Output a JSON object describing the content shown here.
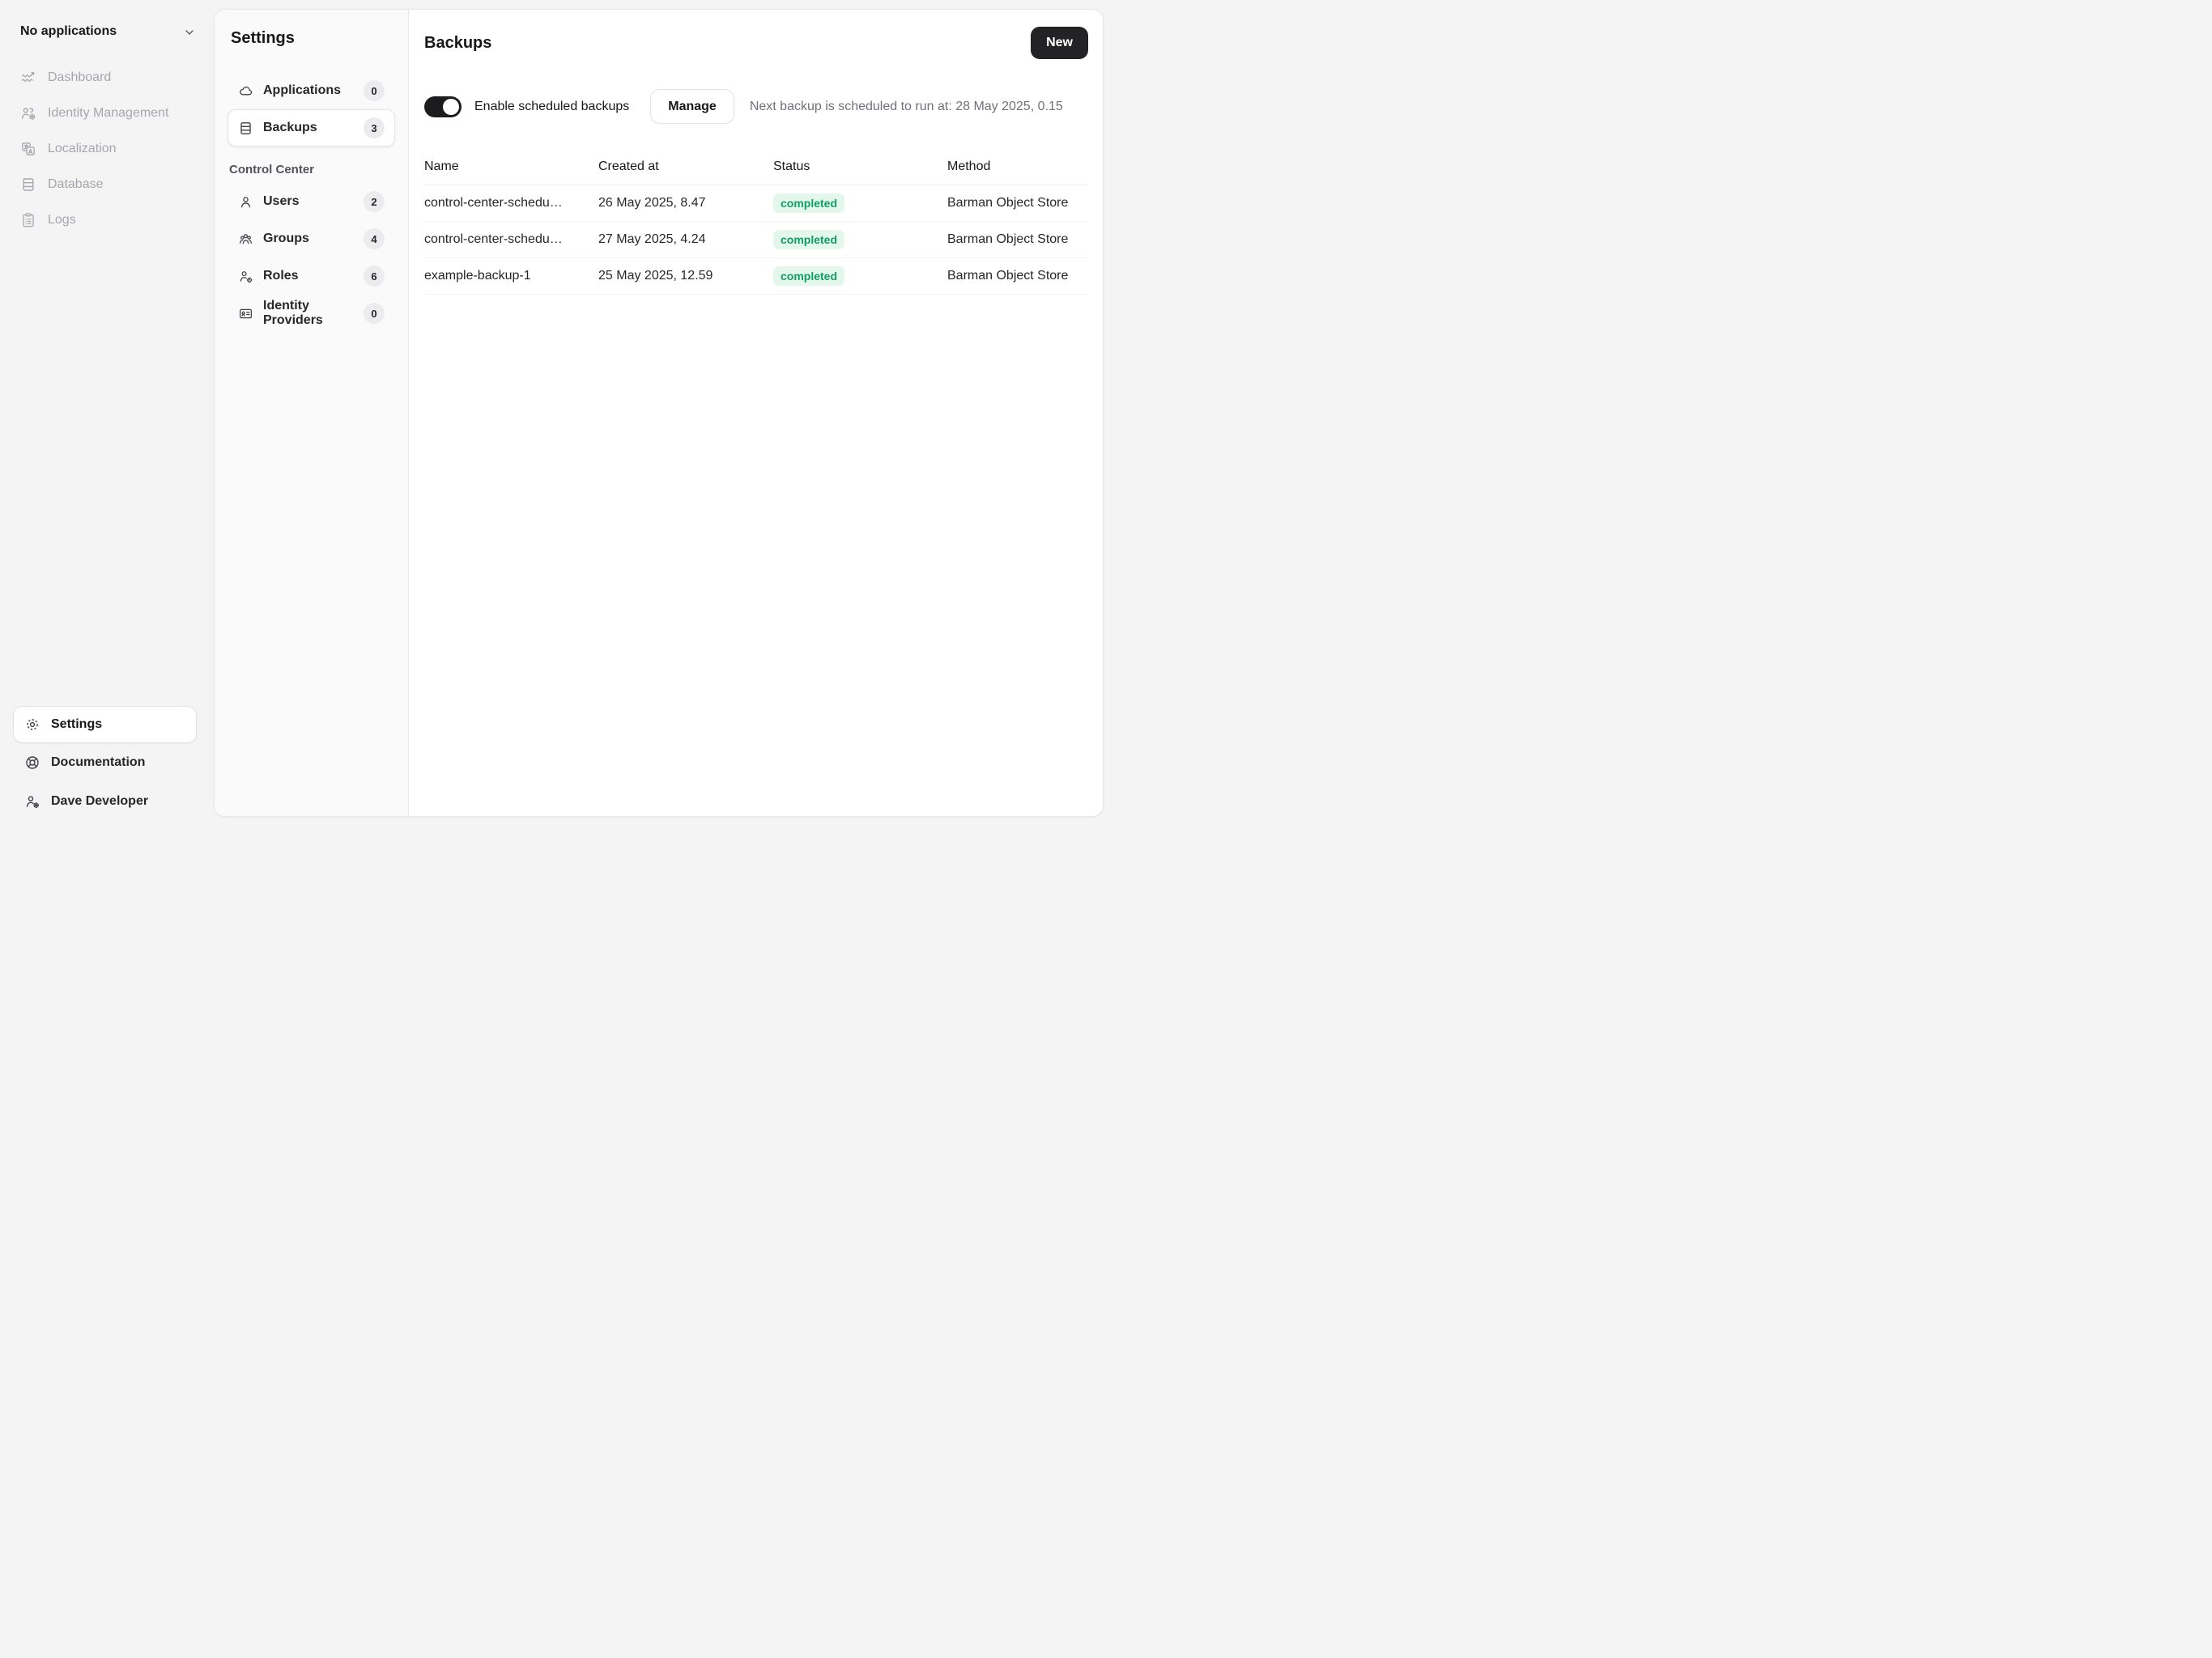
{
  "sidebar": {
    "app_switcher": {
      "label": "No applications"
    },
    "nav": [
      {
        "label": "Dashboard",
        "icon": "activity-icon"
      },
      {
        "label": "Identity Management",
        "icon": "users-gear-icon"
      },
      {
        "label": "Localization",
        "icon": "translate-icon"
      },
      {
        "label": "Database",
        "icon": "database-icon"
      },
      {
        "label": "Logs",
        "icon": "logs-icon"
      }
    ],
    "footer": {
      "settings_label": "Settings",
      "documentation_label": "Documentation",
      "user_label": "Dave Developer"
    }
  },
  "settings_nav": {
    "title": "Settings",
    "items": [
      {
        "label": "Applications",
        "count": "0",
        "icon": "cloud-icon",
        "active": false
      },
      {
        "label": "Backups",
        "count": "3",
        "icon": "rows-icon",
        "active": true
      }
    ],
    "section_label": "Control Center",
    "section_items": [
      {
        "label": "Users",
        "count": "2",
        "icon": "user-icon"
      },
      {
        "label": "Groups",
        "count": "4",
        "icon": "group-icon"
      },
      {
        "label": "Roles",
        "count": "6",
        "icon": "role-icon"
      },
      {
        "label": "Identity Providers",
        "count": "0",
        "icon": "id-card-icon"
      }
    ]
  },
  "main": {
    "title": "Backups",
    "new_button_label": "New",
    "scheduled_backups": {
      "enabled": true,
      "toggle_label": "Enable scheduled backups",
      "manage_button_label": "Manage",
      "schedule_note": "Next backup is scheduled to run at: 28 May 2025, 0.15"
    },
    "table": {
      "headers": [
        "Name",
        "Created at",
        "Status",
        "Method"
      ],
      "rows": [
        {
          "name": "control-center-schedu…",
          "created_at": "26 May 2025, 8.47",
          "status": "completed",
          "method": "Barman Object Store"
        },
        {
          "name": "control-center-schedu…",
          "created_at": "27 May 2025, 4.24",
          "status": "completed",
          "method": "Barman Object Store"
        },
        {
          "name": "example-backup-1",
          "created_at": "25 May 2025, 12.59",
          "status": "completed",
          "method": "Barman Object Store"
        }
      ]
    }
  },
  "colors": {
    "page_background": "#f4f4f5",
    "panel_background": "#ffffff",
    "primary_button": "#232325",
    "status_completed_bg": "#e4f7ed",
    "status_completed_text": "#0f9d63",
    "muted_text": "#a6a6ad",
    "note_text": "#71717a"
  }
}
